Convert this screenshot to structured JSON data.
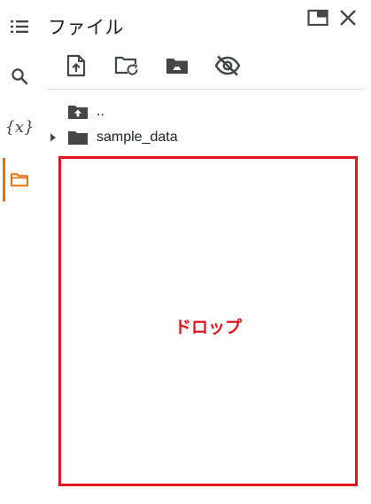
{
  "panel": {
    "title": "ファイル"
  },
  "rail": {
    "items": [
      {
        "icon": "toc-list-icon"
      },
      {
        "icon": "search-icon"
      },
      {
        "icon": "variables-icon",
        "glyph": "{x}"
      },
      {
        "icon": "folder-icon",
        "active": true
      }
    ],
    "active_color": "#e8710a"
  },
  "title_icons": [
    "open-in-tab-icon",
    "close-icon"
  ],
  "toolbar": [
    "upload-file-icon",
    "refresh-folder-icon",
    "mount-drive-icon",
    "hide-files-icon"
  ],
  "tree": [
    {
      "label": "..",
      "icon": "parent-folder-icon"
    },
    {
      "label": "sample_data",
      "icon": "folder-icon",
      "collapsed": true
    }
  ],
  "drop_zone": {
    "label": "ドロップ",
    "color": "#e0161e"
  }
}
